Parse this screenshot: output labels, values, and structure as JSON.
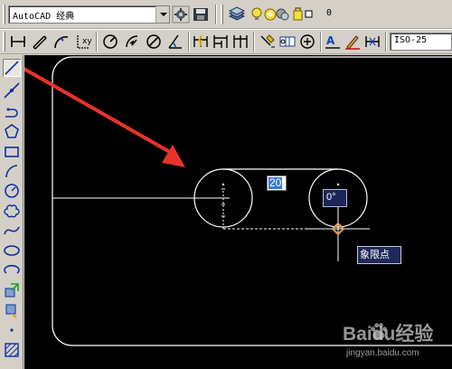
{
  "toolbar": {
    "workspace_name": "AutoCAD 经典",
    "layer_name": "0",
    "dim_style": "ISO-25"
  },
  "drawing": {
    "dynamic_input_value": "20",
    "angle_tooltip": "0°",
    "snap_tooltip": "象限点"
  },
  "watermark": {
    "brand": "Baidu经验",
    "url": "jingyan.baidu.com"
  },
  "colors": {
    "canvas_bg": "#000000",
    "arrow": "#e8332a",
    "snap_marker": "#e0a050",
    "input_highlight": "#3a78d8"
  }
}
